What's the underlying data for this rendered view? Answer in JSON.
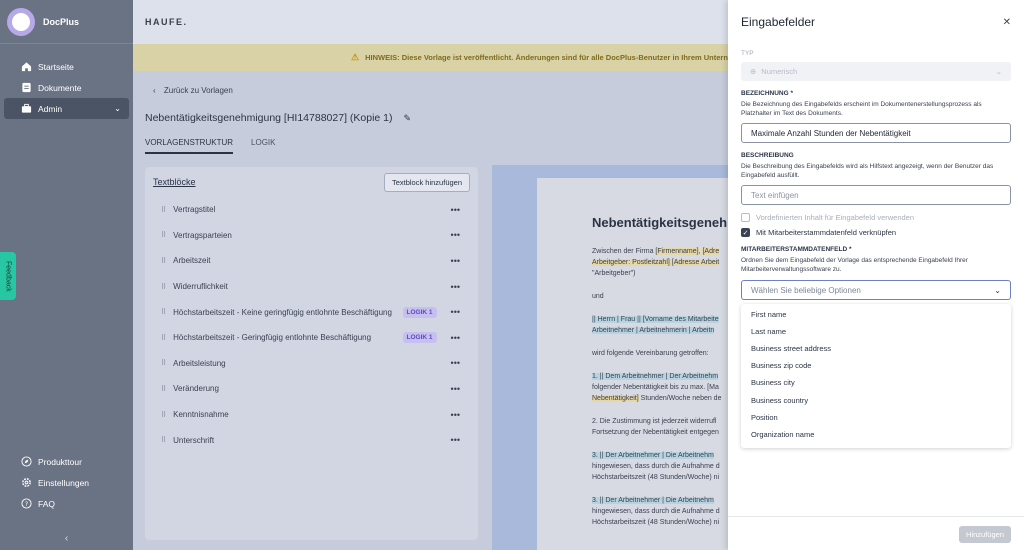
{
  "sidebar": {
    "brand": "DocPlus",
    "items": [
      {
        "label": "Startseite",
        "icon": "home-icon"
      },
      {
        "label": "Dokumente",
        "icon": "document-icon"
      },
      {
        "label": "Admin",
        "icon": "briefcase-icon"
      }
    ],
    "bottom_items": [
      {
        "label": "Produkttour",
        "icon": "compass-icon"
      },
      {
        "label": "Einstellungen",
        "icon": "gear-icon"
      },
      {
        "label": "FAQ",
        "icon": "question-icon"
      }
    ],
    "collapse": "‹",
    "feedback": "Feedback"
  },
  "header": {
    "logo": "HAUFE."
  },
  "notice": {
    "text": "HINWEIS: Diese Vorlage ist veröffentlicht. Änderungen sind für alle DocPlus-Benutzer in Ihrem Untern"
  },
  "main": {
    "back": "Zurück zu Vorlagen",
    "title": "Nebentätigkeitsgenehmigung [HI14788027] (Kopie 1)",
    "tabs": [
      "VORLAGENSTRUKTUR",
      "LOGIK"
    ]
  },
  "blocks": {
    "title": "Textblöcke",
    "add_label": "Textblock hinzufügen",
    "items": [
      {
        "label": "Vertragstitel",
        "logic": ""
      },
      {
        "label": "Vertragsparteien",
        "logic": ""
      },
      {
        "label": "Arbeitszeit",
        "logic": ""
      },
      {
        "label": "Widerruflichkeit",
        "logic": ""
      },
      {
        "label": "Höchstarbeitszeit - Keine geringfügig entlohnte Beschäftigung",
        "logic": "LOGIK 1"
      },
      {
        "label": "Höchstarbeitszeit - Geringfügig entlohnte Beschäftigung",
        "logic": "LOGIK 1"
      },
      {
        "label": "Arbeitsleistung",
        "logic": ""
      },
      {
        "label": "Veränderung",
        "logic": ""
      },
      {
        "label": "Kenntnisnahme",
        "logic": ""
      },
      {
        "label": "Unterschrift",
        "logic": ""
      }
    ]
  },
  "preview": {
    "heading": "Nebentätigkeitsgenehmi",
    "p1a": "Zwischen der Firma ",
    "p1b": "[Firmenname]",
    "p1c": ", ",
    "p1d": "[Adre",
    "p1e": "Arbeitgeber: Postleitzahl] [Adresse Arbeit",
    "p1f": "\"Arbeitgeber\")",
    "p2": "und",
    "p3a": "|| Herrn | Frau || [Vorname des Mitarbeite",
    "p3b": "Arbeitnehmer | Arbeitnehmerin | Arbeitn",
    "p4": "wird folgende Vereinbarung getroffen:",
    "p5a": "1. || Dem Arbeitnehmer | Der Arbeitnehm",
    "p5b": "folgender Nebentätigkeit bis zu max. [Ma",
    "p5c": "Nebentätigkeit]",
    "p5d": " Stunden/Woche neben de",
    "p6a": "2. Die Zustimmung ist jederzeit widerrufl",
    "p6b": "Fortsetzung der Nebentätigkeit entgegen",
    "p7a": "3. || Der Arbeitnehmer | Die Arbeitnehm",
    "p7b": "hingewiesen, dass durch die Aufnahme d",
    "p7c": "Höchstarbeitszeit (48 Stunden/Woche) ni",
    "p8a": "3. || Der Arbeitnehmer | Die Arbeitnehm",
    "p8b": "hingewiesen, dass durch die Aufnahme d",
    "p8c": "Höchstarbeitszeit (48 Stunden/Woche) ni"
  },
  "drawer": {
    "title": "Eingabefelder",
    "typ_label": "TYP",
    "typ_value": "Numerisch",
    "bez_label": "BEZEICHNUNG *",
    "bez_help": "Die Bezeichnung des Eingabefelds erscheint im Dokumentenerstellungsprozess als Platzhalter im Text des Dokuments.",
    "bez_value": "Maximale Anzahl Stunden der Nebentätigkeit",
    "beschr_label": "BESCHREIBUNG",
    "beschr_help": "Die Beschreibung des Eingabefelds wird als Hilfstext angezeigt, wenn der Benutzer das Eingabefeld ausfüllt.",
    "beschr_placeholder": "Text einfügen",
    "check1": "Vordefinierten Inhalt für Eingabefeld verwenden",
    "check2": "Mit Mitarbeiterstammdatenfeld verknüpfen",
    "ma_label": "MITARBEITERSTAMMDATENFELD *",
    "ma_help": "Ordnen Sie dem Eingabefeld der Vorlage das entsprechende Eingabefeld Ihrer Mitarbeiterverwaltungssoftware zu.",
    "ma_placeholder": "Wählen Sie beliebige Optionen",
    "options": [
      "First name",
      "Last name",
      "Business street address",
      "Business zip code",
      "Business city",
      "Business country",
      "Position",
      "Organization name"
    ],
    "submit": "Hinzufügen"
  }
}
